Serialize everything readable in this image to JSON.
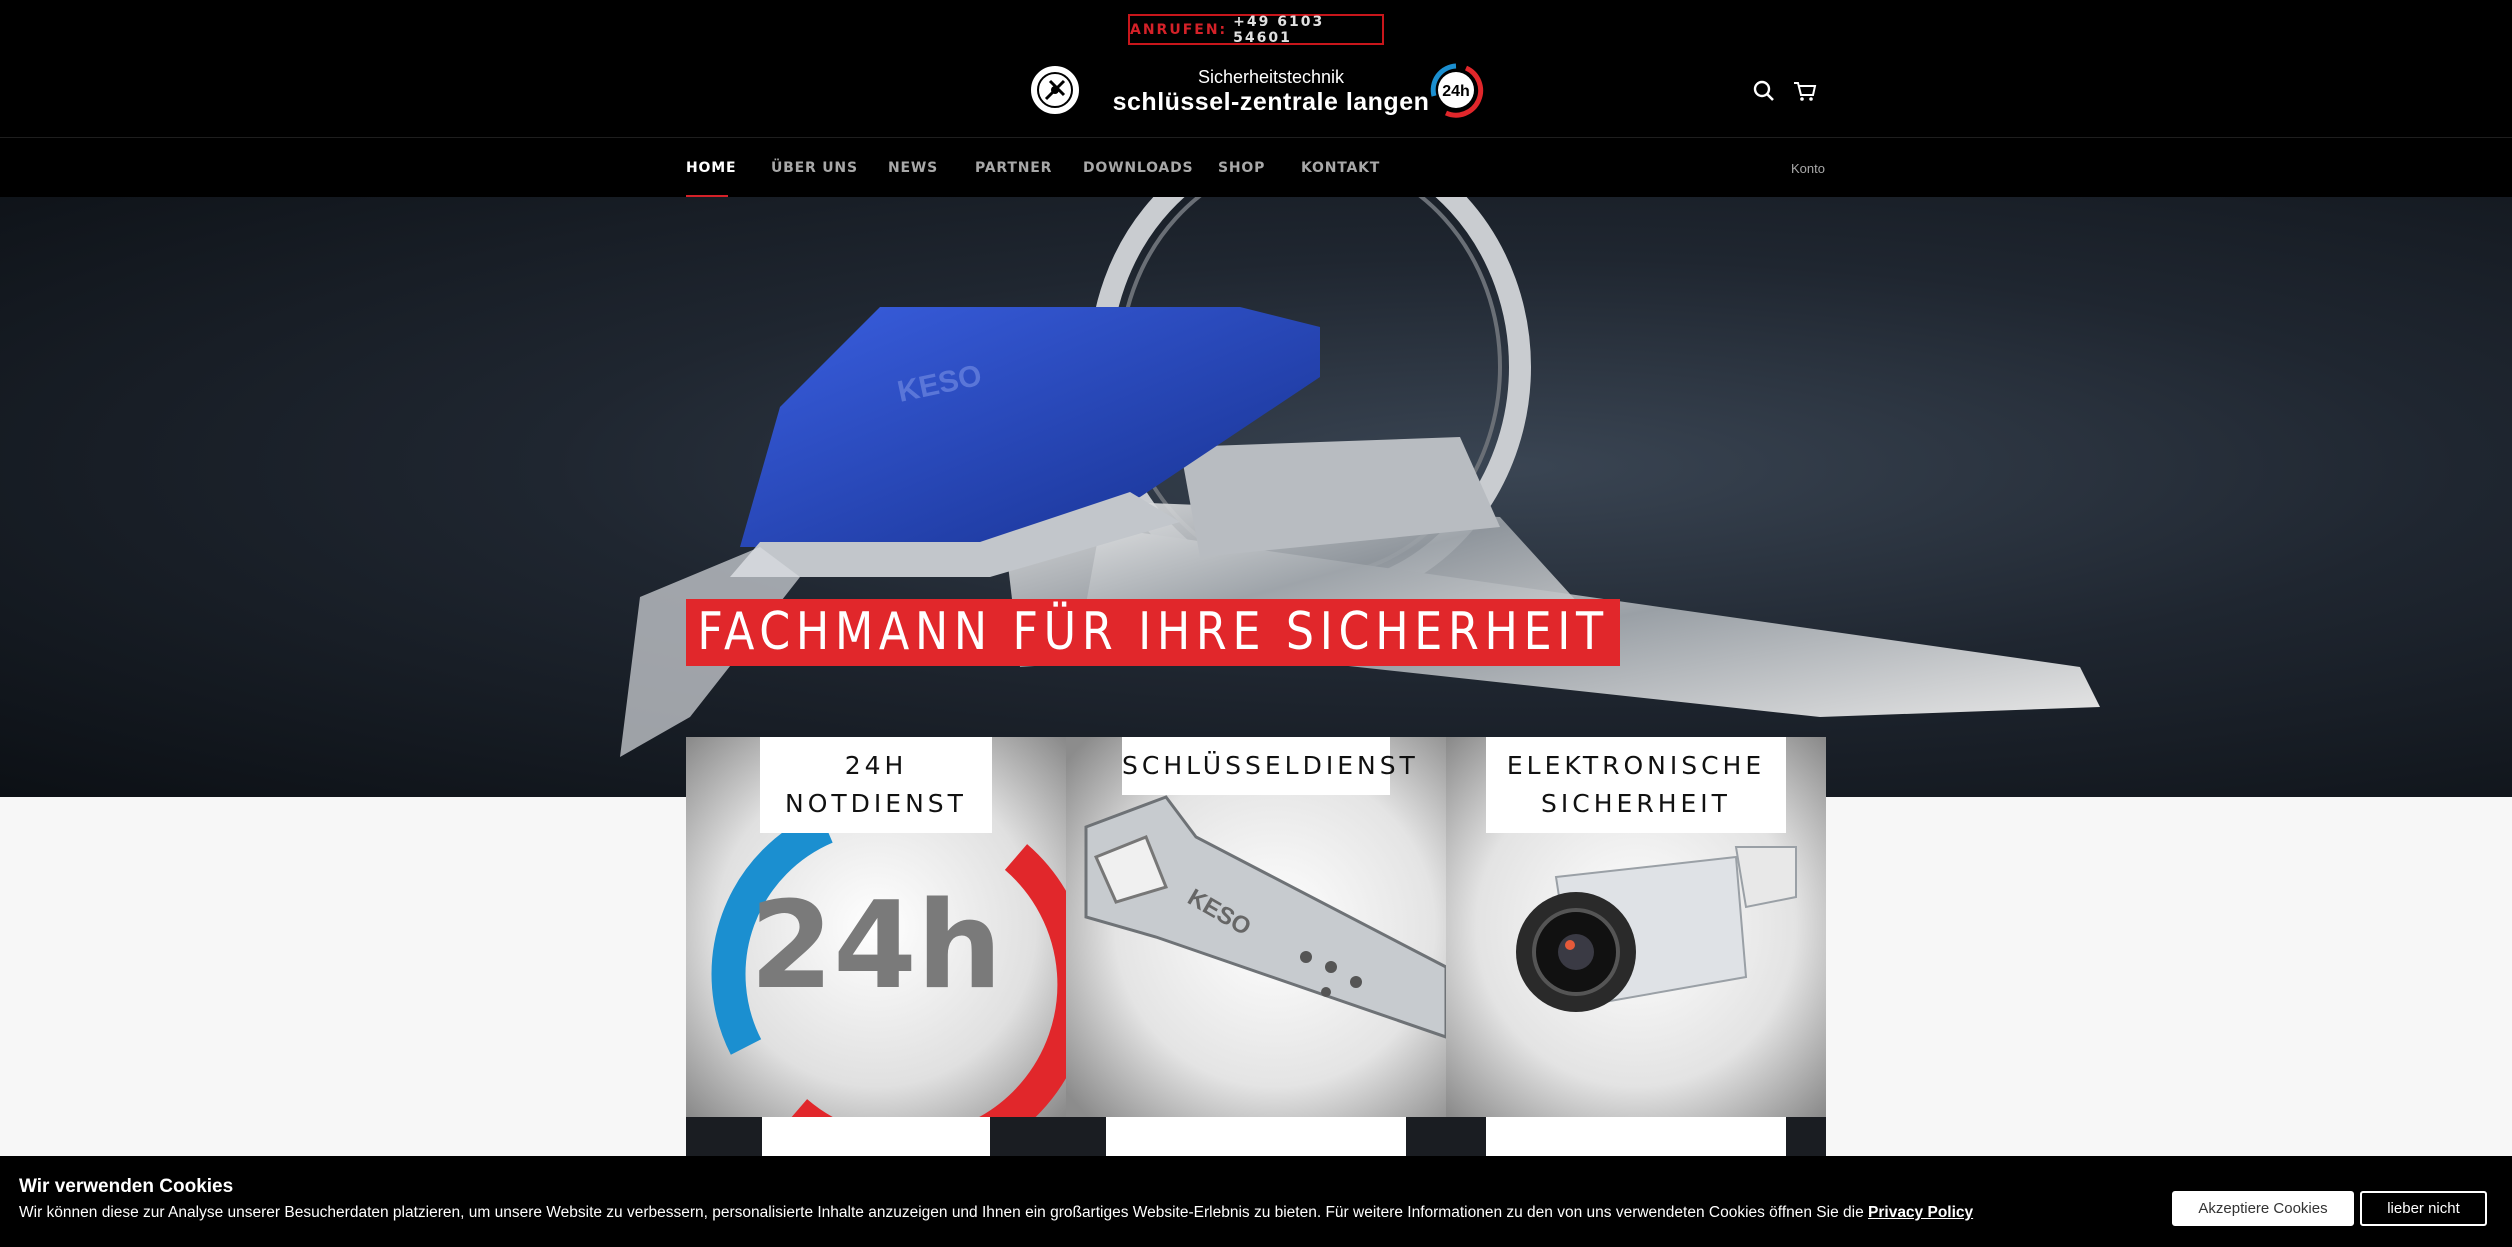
{
  "header": {
    "call_label": "ANRUFEN:",
    "call_number": "+49 6103 54601",
    "logo_line1": "Sicherheitstechnik",
    "logo_line2": "schlüssel-zentrale langen",
    "logo_badge": "24h",
    "search_icon": "search-icon",
    "cart_icon": "cart-icon"
  },
  "nav": {
    "items": [
      "HOME",
      "ÜBER UNS",
      "NEWS",
      "PARTNER",
      "DOWNLOADS",
      "SHOP",
      "KONTAKT"
    ],
    "active": "HOME",
    "account": "Konto"
  },
  "hero": {
    "title": "FACHMANN FÜR IHRE SICHERHEIT",
    "key_brand": "KESO"
  },
  "tiles": [
    {
      "label": "24H NOTDIENST",
      "image_text": "24h"
    },
    {
      "label": "SCHLÜSSELDIENST",
      "image_text": "KESO"
    },
    {
      "label": "ELEKTRONISCHE SICHERHEIT"
    }
  ],
  "cookie": {
    "title": "Wir verwenden Cookies",
    "text": "Wir können diese zur Analyse unserer Besucherdaten platzieren, um unsere Website zu verbessern, personalisierte Inhalte anzuzeigen und Ihnen ein großartiges Website-Erlebnis zu bieten. Für weitere Informationen zu den von uns verwendeten Cookies öffnen Sie die",
    "link": "Privacy Policy",
    "accept": "Akzeptiere Cookies",
    "deny": "lieber nicht"
  },
  "colors": {
    "accent_red": "#e1272b",
    "badge_blue": "#1b8fd0",
    "background": "#000000"
  }
}
